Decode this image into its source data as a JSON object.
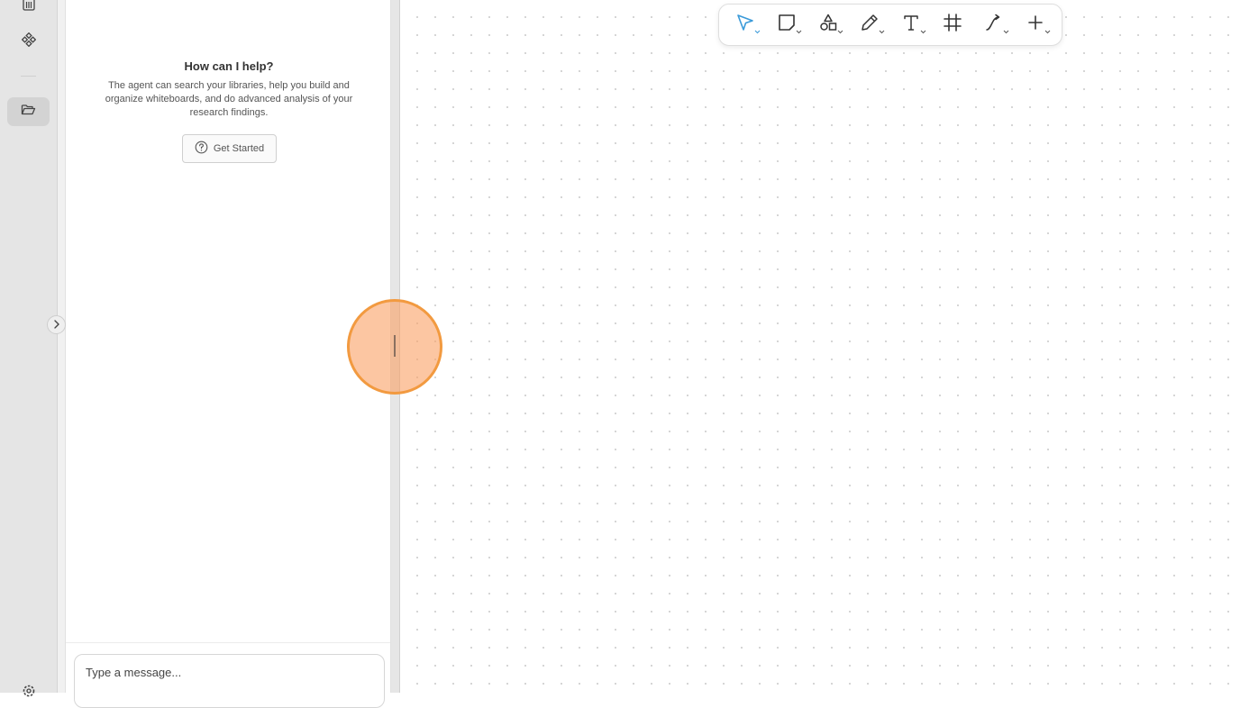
{
  "rail": {
    "icons": [
      "library-icon",
      "components-icon",
      "folder-open-icon",
      "settings-icon"
    ],
    "active_item": "folder-open-icon"
  },
  "agent_panel": {
    "title": "How can I help?",
    "description": "The agent can search your libraries, help you build and organize whiteboards, and do advanced analysis of your research findings.",
    "get_started_label": "Get Started",
    "composer_placeholder": "Type a message..."
  },
  "toolbar": {
    "tools": [
      {
        "name": "select-tool",
        "icon": "cursor-arrow-icon",
        "active": true
      },
      {
        "name": "note-tool",
        "icon": "sticky-note-icon"
      },
      {
        "name": "shapes-tool",
        "icon": "shapes-icon"
      },
      {
        "name": "pen-tool",
        "icon": "pencil-icon"
      },
      {
        "name": "text-tool",
        "icon": "text-icon"
      },
      {
        "name": "frame-tool",
        "icon": "frame-hash-icon"
      },
      {
        "name": "connector-tool",
        "icon": "connector-icon"
      },
      {
        "name": "add-tool",
        "icon": "plus-icon"
      }
    ],
    "accent_color": "#3a9ad9"
  }
}
